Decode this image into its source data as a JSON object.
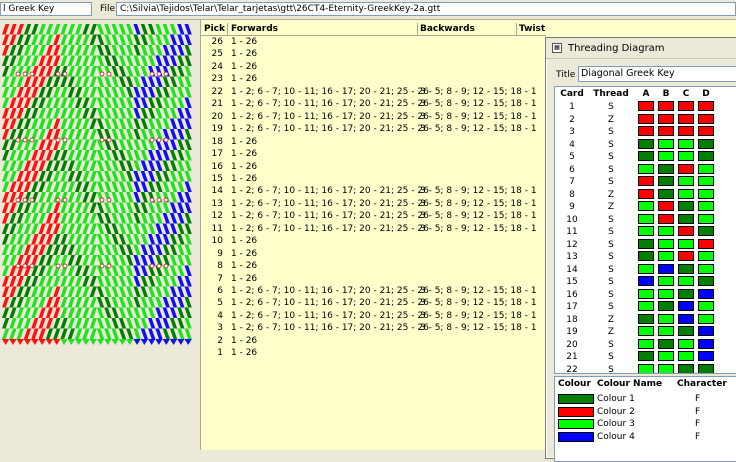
{
  "toolbar": {
    "pattern_name": "l Greek Key",
    "file_label": "File",
    "file_path": "C:\\Silvia\\Tejidos\\Telar\\Telar_tarjetas\\gtt\\26CT4-Eternity-GreekKey-2a.gtt"
  },
  "picks_table": {
    "headers": {
      "pick": "Pick",
      "forwards": "Forwards",
      "backwards": "Backwards",
      "twist": "Twist"
    },
    "rows": [
      {
        "pick": "26",
        "forwards": "1 - 26",
        "backwards": ""
      },
      {
        "pick": "25",
        "forwards": "1 - 26",
        "backwards": ""
      },
      {
        "pick": "24",
        "forwards": "1 - 26",
        "backwards": ""
      },
      {
        "pick": "23",
        "forwards": "1 - 26",
        "backwards": ""
      },
      {
        "pick": "22",
        "forwards": "1 - 2; 6 - 7; 10 - 11; 16 - 17; 20 - 21; 25 - 26",
        "backwards": "3 - 5; 8 - 9; 12 - 15; 18 - 1"
      },
      {
        "pick": "21",
        "forwards": "1 - 2; 6 - 7; 10 - 11; 16 - 17; 20 - 21; 25 - 26",
        "backwards": "3 - 5; 8 - 9; 12 - 15; 18 - 1"
      },
      {
        "pick": "20",
        "forwards": "1 - 2; 6 - 7; 10 - 11; 16 - 17; 20 - 21; 25 - 26",
        "backwards": "3 - 5; 8 - 9; 12 - 15; 18 - 1"
      },
      {
        "pick": "19",
        "forwards": "1 - 2; 6 - 7; 10 - 11; 16 - 17; 20 - 21; 25 - 26",
        "backwards": "3 - 5; 8 - 9; 12 - 15; 18 - 1"
      },
      {
        "pick": "18",
        "forwards": "1 - 26",
        "backwards": ""
      },
      {
        "pick": "17",
        "forwards": "1 - 26",
        "backwards": ""
      },
      {
        "pick": "16",
        "forwards": "1 - 26",
        "backwards": ""
      },
      {
        "pick": "15",
        "forwards": "1 - 26",
        "backwards": ""
      },
      {
        "pick": "14",
        "forwards": "1 - 2; 6 - 7; 10 - 11; 16 - 17; 20 - 21; 25 - 26",
        "backwards": "3 - 5; 8 - 9; 12 - 15; 18 - 1"
      },
      {
        "pick": "13",
        "forwards": "1 - 2; 6 - 7; 10 - 11; 16 - 17; 20 - 21; 25 - 26",
        "backwards": "3 - 5; 8 - 9; 12 - 15; 18 - 1"
      },
      {
        "pick": "12",
        "forwards": "1 - 2; 6 - 7; 10 - 11; 16 - 17; 20 - 21; 25 - 26",
        "backwards": "3 - 5; 8 - 9; 12 - 15; 18 - 1"
      },
      {
        "pick": "11",
        "forwards": "1 - 2; 6 - 7; 10 - 11; 16 - 17; 20 - 21; 25 - 26",
        "backwards": "3 - 5; 8 - 9; 12 - 15; 18 - 1"
      },
      {
        "pick": "10",
        "forwards": "1 - 26",
        "backwards": ""
      },
      {
        "pick": "9",
        "forwards": "1 - 26",
        "backwards": ""
      },
      {
        "pick": "8",
        "forwards": "1 - 26",
        "backwards": ""
      },
      {
        "pick": "7",
        "forwards": "1 - 26",
        "backwards": ""
      },
      {
        "pick": "6",
        "forwards": "1 - 2; 6 - 7; 10 - 11; 16 - 17; 20 - 21; 25 - 26",
        "backwards": "3 - 5; 8 - 9; 12 - 15; 18 - 1"
      },
      {
        "pick": "5",
        "forwards": "1 - 2; 6 - 7; 10 - 11; 16 - 17; 20 - 21; 25 - 26",
        "backwards": "3 - 5; 8 - 9; 12 - 15; 18 - 1"
      },
      {
        "pick": "4",
        "forwards": "1 - 2; 6 - 7; 10 - 11; 16 - 17; 20 - 21; 25 - 26",
        "backwards": "3 - 5; 8 - 9; 12 - 15; 18 - 1"
      },
      {
        "pick": "3",
        "forwards": "1 - 2; 6 - 7; 10 - 11; 16 - 17; 20 - 21; 25 - 26",
        "backwards": "3 - 5; 8 - 9; 12 - 15; 18 - 1"
      },
      {
        "pick": "2",
        "forwards": "1 - 26",
        "backwards": ""
      },
      {
        "pick": "1",
        "forwards": "1 - 26",
        "backwards": ""
      }
    ]
  },
  "threading_dialog": {
    "window_title": "Threading Diagram",
    "title_label": "Title",
    "title_value": "Diagonal Greek Key",
    "card_headers": {
      "card": "Card",
      "thread": "Thread",
      "a": "A",
      "b": "B",
      "c": "C",
      "d": "D"
    },
    "cards": [
      {
        "card": "1",
        "thread": "S",
        "holes": [
          2,
          2,
          2,
          2
        ]
      },
      {
        "card": "2",
        "thread": "Z",
        "holes": [
          2,
          2,
          2,
          2
        ]
      },
      {
        "card": "3",
        "thread": "S",
        "holes": [
          2,
          2,
          2,
          2
        ]
      },
      {
        "card": "4",
        "thread": "S",
        "holes": [
          1,
          3,
          3,
          1
        ]
      },
      {
        "card": "5",
        "thread": "S",
        "holes": [
          1,
          3,
          3,
          1
        ]
      },
      {
        "card": "6",
        "thread": "S",
        "holes": [
          3,
          1,
          2,
          3
        ]
      },
      {
        "card": "7",
        "thread": "S",
        "holes": [
          2,
          1,
          3,
          3
        ]
      },
      {
        "card": "8",
        "thread": "Z",
        "holes": [
          2,
          1,
          3,
          3
        ]
      },
      {
        "card": "9",
        "thread": "Z",
        "holes": [
          3,
          2,
          1,
          3
        ]
      },
      {
        "card": "10",
        "thread": "S",
        "holes": [
          3,
          2,
          1,
          3
        ]
      },
      {
        "card": "11",
        "thread": "S",
        "holes": [
          3,
          3,
          2,
          1
        ]
      },
      {
        "card": "12",
        "thread": "S",
        "holes": [
          1,
          3,
          3,
          2
        ]
      },
      {
        "card": "13",
        "thread": "S",
        "holes": [
          1,
          3,
          2,
          3
        ]
      },
      {
        "card": "14",
        "thread": "S",
        "holes": [
          3,
          4,
          1,
          3
        ]
      },
      {
        "card": "15",
        "thread": "S",
        "holes": [
          4,
          3,
          3,
          1
        ]
      },
      {
        "card": "16",
        "thread": "S",
        "holes": [
          3,
          3,
          1,
          4
        ]
      },
      {
        "card": "17",
        "thread": "S",
        "holes": [
          3,
          1,
          4,
          3
        ]
      },
      {
        "card": "18",
        "thread": "Z",
        "holes": [
          1,
          3,
          4,
          3
        ]
      },
      {
        "card": "19",
        "thread": "Z",
        "holes": [
          3,
          3,
          1,
          4
        ]
      },
      {
        "card": "20",
        "thread": "S",
        "holes": [
          3,
          1,
          3,
          4
        ]
      },
      {
        "card": "21",
        "thread": "S",
        "holes": [
          1,
          3,
          3,
          4
        ]
      },
      {
        "card": "22",
        "thread": "S",
        "holes": [
          3,
          3,
          1,
          1
        ]
      }
    ],
    "colour_headers": {
      "colour": "Colour",
      "name": "Colour Name",
      "character": "Character"
    },
    "colours": [
      {
        "hex": "#007f00",
        "name": "Colour 1",
        "character": "F"
      },
      {
        "hex": "#ff0000",
        "name": "Colour 2",
        "character": "F"
      },
      {
        "hex": "#00ff00",
        "name": "Colour 3",
        "character": "F"
      },
      {
        "hex": "#0000ff",
        "name": "Colour 4",
        "character": "F"
      }
    ]
  },
  "colors": {
    "green_dark": "#008000",
    "red": "#ff1111",
    "green_light": "#22e022",
    "blue": "#1111ee",
    "panel_bg": "#ffffcc",
    "chrome_bg": "#ece9d8"
  }
}
